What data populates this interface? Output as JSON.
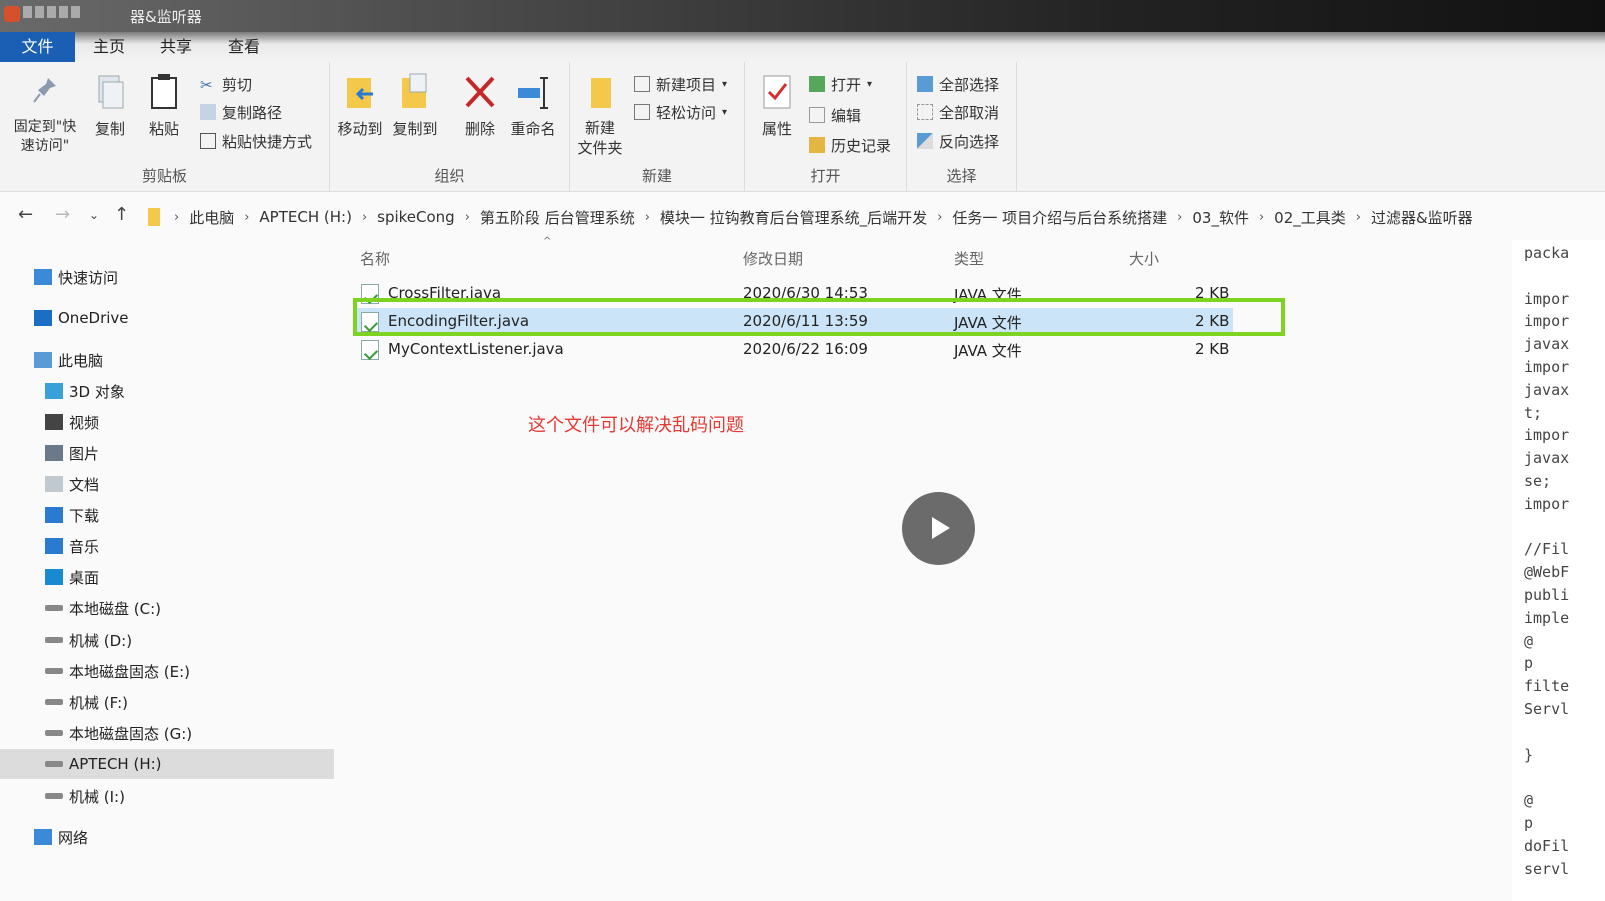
{
  "window": {
    "title": "器&监听器"
  },
  "tabs": [
    "文件",
    "主页",
    "共享",
    "查看"
  ],
  "ribbon": {
    "clipboard": {
      "label": "剪贴板",
      "pin": "固定到\"快速访问\"",
      "copy": "复制",
      "paste": "粘贴",
      "cut": "剪切",
      "copy_path": "复制路径",
      "paste_shortcut": "粘贴快捷方式"
    },
    "organize": {
      "label": "组织",
      "move_to": "移动到",
      "copy_to": "复制到",
      "delete": "删除",
      "rename": "重命名"
    },
    "new": {
      "label": "新建",
      "new_folder": "新建\n文件夹",
      "new_item": "新建项目",
      "easy_access": "轻松访问"
    },
    "open": {
      "label": "打开",
      "properties": "属性",
      "open": "打开",
      "edit": "编辑",
      "history": "历史记录"
    },
    "select": {
      "label": "选择",
      "select_all": "全部选择",
      "select_none": "全部取消",
      "invert": "反向选择"
    }
  },
  "breadcrumb": [
    "此电脑",
    "APTECH (H:)",
    "spikeCong",
    "第五阶段 后台管理系统",
    "模块一 拉钩教育后台管理系统_后端开发",
    "任务一 项目介绍与后台系统搭建",
    "03_软件",
    "02_工具类",
    "过滤器&监听器"
  ],
  "nav": [
    {
      "label": "快速访问",
      "icon": "star-icon",
      "indent": 0
    },
    {
      "label": "OneDrive",
      "icon": "cloud-icon",
      "indent": 0
    },
    {
      "label": "此电脑",
      "icon": "computer-icon",
      "indent": 0
    },
    {
      "label": "3D 对象",
      "icon": "cube-icon",
      "indent": 1
    },
    {
      "label": "视频",
      "icon": "video-icon",
      "indent": 1
    },
    {
      "label": "图片",
      "icon": "picture-icon",
      "indent": 1
    },
    {
      "label": "文档",
      "icon": "document-icon",
      "indent": 1
    },
    {
      "label": "下载",
      "icon": "download-icon",
      "indent": 1
    },
    {
      "label": "音乐",
      "icon": "music-icon",
      "indent": 1
    },
    {
      "label": "桌面",
      "icon": "desktop-icon",
      "indent": 1
    },
    {
      "label": "本地磁盘 (C:)",
      "icon": "drive-icon",
      "indent": 1
    },
    {
      "label": "机械 (D:)",
      "icon": "drive-icon",
      "indent": 1
    },
    {
      "label": "本地磁盘固态 (E:)",
      "icon": "drive-icon",
      "indent": 1
    },
    {
      "label": "机械 (F:)",
      "icon": "drive-icon",
      "indent": 1
    },
    {
      "label": "本地磁盘固态 (G:)",
      "icon": "drive-icon",
      "indent": 1
    },
    {
      "label": "APTECH (H:)",
      "icon": "drive-icon",
      "indent": 1,
      "selected": true
    },
    {
      "label": "机械 (I:)",
      "icon": "drive-icon",
      "indent": 1
    },
    {
      "label": "网络",
      "icon": "network-icon",
      "indent": 0
    }
  ],
  "columns": {
    "name": "名称",
    "modified": "修改日期",
    "type": "类型",
    "size": "大小"
  },
  "files": [
    {
      "name": "CrossFilter.java",
      "modified": "2020/6/30 14:53",
      "type": "JAVA 文件",
      "size": "2 KB"
    },
    {
      "name": "EncodingFilter.java",
      "modified": "2020/6/11 13:59",
      "type": "JAVA 文件",
      "size": "2 KB",
      "selected": true
    },
    {
      "name": "MyContextListener.java",
      "modified": "2020/6/22 16:09",
      "type": "JAVA 文件",
      "size": "2 KB"
    }
  ],
  "annotation": "这个文件可以解决乱码问题",
  "preview_lines": [
    "packa",
    "",
    "impor",
    "impor",
    "javax",
    "impor",
    "javax",
    "t;",
    "impor",
    "javax",
    "se;",
    "impor",
    "",
    "//Fil",
    "@WebF",
    "publi",
    "imple",
    "  @",
    "  p",
    "filte",
    "Servl",
    "",
    "  }",
    "",
    "  @",
    "  p",
    "doFil",
    "servl"
  ],
  "colors": {
    "file_tab": "#1a5fb4",
    "highlight_box": "#7ed321",
    "annotation": "#e53935",
    "selection": "#cce4f7"
  }
}
